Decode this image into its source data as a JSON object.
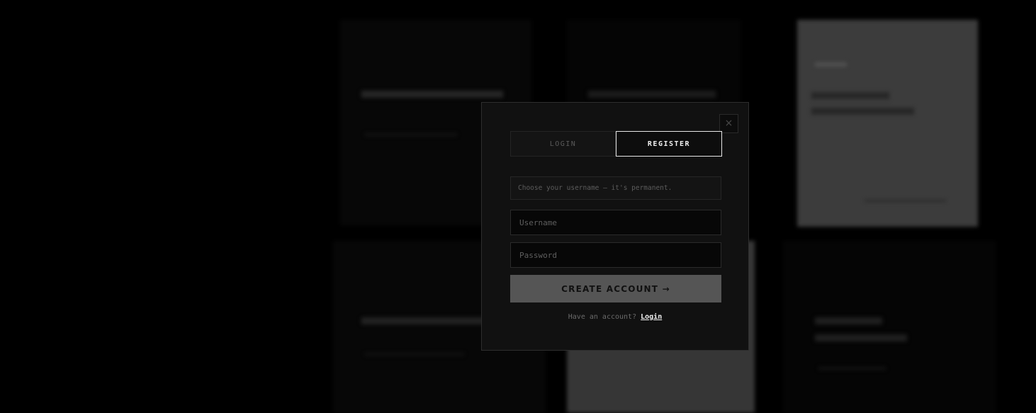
{
  "modal": {
    "close_icon": "×",
    "tabs": [
      {
        "label": "LOGIN",
        "active": false
      },
      {
        "label": "REGISTER",
        "active": true
      }
    ],
    "notice": "Choose your username — it's permanent.",
    "username": {
      "value": "",
      "placeholder": "Username"
    },
    "password": {
      "value": "",
      "placeholder": "Password"
    },
    "submit_label": "CREATE ACCOUNT →",
    "footer_prompt": "Have an account?",
    "footer_link": "Login"
  },
  "colors": {
    "background": "#000000",
    "modal_bg": "#111111",
    "active_tab_border": "#e8e8e8",
    "submit_bg": "#555555",
    "link": "#f2f2f2"
  }
}
